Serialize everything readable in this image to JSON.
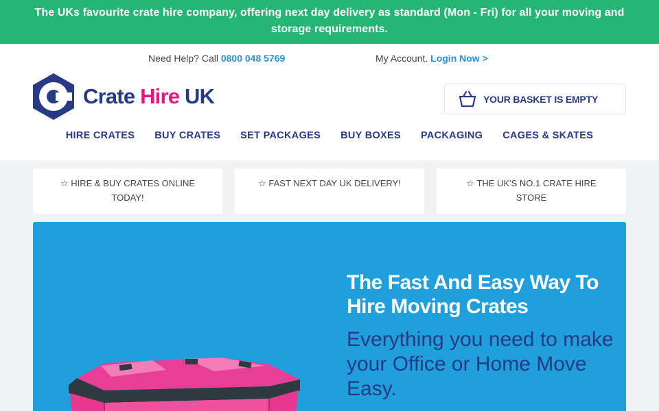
{
  "promo": {
    "text": "The UKs favourite crate hire company, offering next day delivery as standard (Mon - Fri) for all your moving and storage requirements."
  },
  "topbar": {
    "help_prefix": "Need Help? Call ",
    "phone": "0800 048 5769",
    "account_prefix": "My Account. ",
    "login_label": "Login Now >"
  },
  "logo": {
    "word1": "Crate",
    "word2": "Hire",
    "word3": "UK",
    "icon": "c-hexagon-logo",
    "brand_blue": "#263b84",
    "brand_pink": "#e5177e"
  },
  "basket": {
    "label": "YOUR BASKET IS EMPTY",
    "icon": "basket-icon"
  },
  "nav": {
    "items": [
      "HIRE CRATES",
      "BUY CRATES",
      "SET PACKAGES",
      "BUY BOXES",
      "PACKAGING",
      "CAGES & SKATES"
    ]
  },
  "features": [
    "☆ HIRE & BUY CRATES ONLINE TODAY!",
    "☆ FAST NEXT DAY UK DELIVERY!",
    "☆ THE UK'S NO.1 CRATE HIRE STORE"
  ],
  "hero": {
    "title": "The Fast And Easy Way To Hire Moving Crates",
    "subtitle": "Everything you need to make your Office or Home Move Easy.",
    "background": "#209fdd",
    "image": "pink-crate-image"
  },
  "colors": {
    "promo_green": "#25b574",
    "link_blue": "#2b8fd8"
  }
}
